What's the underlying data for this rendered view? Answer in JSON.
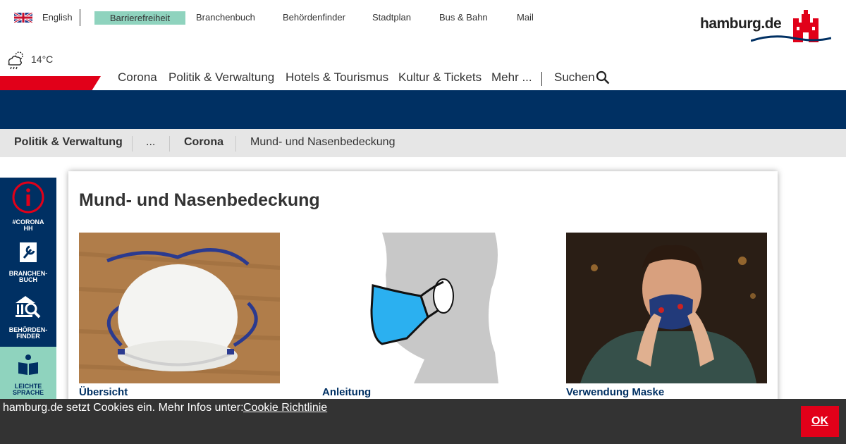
{
  "topbar": {
    "language": "English",
    "links": [
      "Barrierefreiheit",
      "Branchenbuch",
      "Behördenfinder",
      "Stadtplan",
      "Bus & Bahn",
      "Mail"
    ]
  },
  "logo": {
    "text": "hamburg.de"
  },
  "weather": {
    "icon": "cloud-rain-sun-icon",
    "temperature": "14°C"
  },
  "nav": {
    "items": [
      "Corona",
      "Politik & Verwaltung",
      "Hotels & Tourismus",
      "Kultur & Tickets",
      "Mehr ..."
    ],
    "search_label": "Suchen"
  },
  "breadcrumb": [
    "Politik & Verwaltung",
    "...",
    "Corona",
    "Mund- und Nasenbedeckung"
  ],
  "sidebar": {
    "items": [
      {
        "label1": "#CORONA",
        "label2": "HH",
        "icon": "info-icon"
      },
      {
        "label1": "BRANCHEN-",
        "label2": "BUCH",
        "icon": "wrench-book-icon"
      },
      {
        "label1": "BEHÖRDEN-",
        "label2": "FINDER",
        "icon": "building-search-icon"
      },
      {
        "label1": "LEICHTE",
        "label2": "SPRACHE",
        "icon": "open-book-icon"
      }
    ]
  },
  "page": {
    "title": "Mund- und Nasenbedeckung",
    "tiles": [
      {
        "label": "Übersicht",
        "image": "ffp2-mask-photo"
      },
      {
        "label": "Anleitung",
        "image": "mask-illustration"
      },
      {
        "label": "Verwendung Maske",
        "image": "man-wearing-mask-photo"
      }
    ]
  },
  "cookie": {
    "text": "hamburg.de setzt Cookies ein. Mehr Infos unter:",
    "link": "Cookie Richtlinie",
    "ok": "OK"
  },
  "colors": {
    "brand_blue": "#003063",
    "brand_red": "#e10019",
    "accent_green": "#8fd3be",
    "cookie_bg": "#333333"
  }
}
